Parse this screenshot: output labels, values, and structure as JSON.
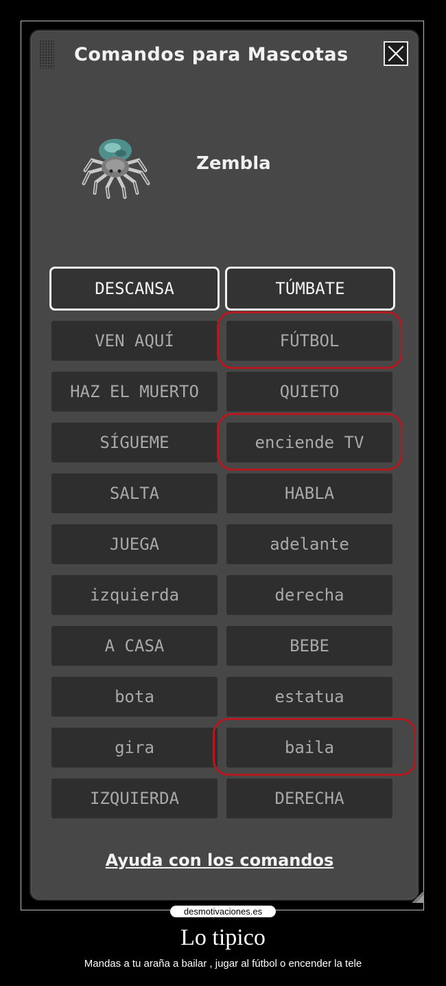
{
  "window": {
    "title": "Comandos para Mascotas",
    "close_icon": "close-icon"
  },
  "pet": {
    "icon": "spider-icon",
    "name": "Zembla"
  },
  "commands": [
    {
      "label": "DESCANSA",
      "active": true
    },
    {
      "label": "TÚMBATE",
      "active": true
    },
    {
      "label": "VEN AQUÍ",
      "active": false
    },
    {
      "label": "FÚTBOL",
      "active": false,
      "highlighted": true
    },
    {
      "label": "HAZ EL MUERTO",
      "active": false
    },
    {
      "label": "QUIETO",
      "active": false
    },
    {
      "label": "SÍGUEME",
      "active": false
    },
    {
      "label": "enciende TV",
      "active": false,
      "highlighted": true
    },
    {
      "label": "SALTA",
      "active": false
    },
    {
      "label": "HABLA",
      "active": false
    },
    {
      "label": "JUEGA",
      "active": false
    },
    {
      "label": "adelante",
      "active": false
    },
    {
      "label": "izquierda",
      "active": false
    },
    {
      "label": "derecha",
      "active": false
    },
    {
      "label": "A CASA",
      "active": false
    },
    {
      "label": "BEBE",
      "active": false
    },
    {
      "label": "bota",
      "active": false
    },
    {
      "label": "estatua",
      "active": false
    },
    {
      "label": "gira",
      "active": false
    },
    {
      "label": "baila",
      "active": false,
      "highlighted": true
    },
    {
      "label": "IZQUIERDA",
      "active": false
    },
    {
      "label": "DERECHA",
      "active": false
    }
  ],
  "help_link": "Ayuda con los comandos",
  "watermark": "desmotivaciones.es",
  "caption": {
    "title": "Lo tipico",
    "subtitle": "Mandas a tu araña a bailar , jugar al fútbol o encender la tele"
  },
  "colors": {
    "panel": "#474747",
    "button": "#2e2e2e",
    "highlight": "#b3191f"
  }
}
